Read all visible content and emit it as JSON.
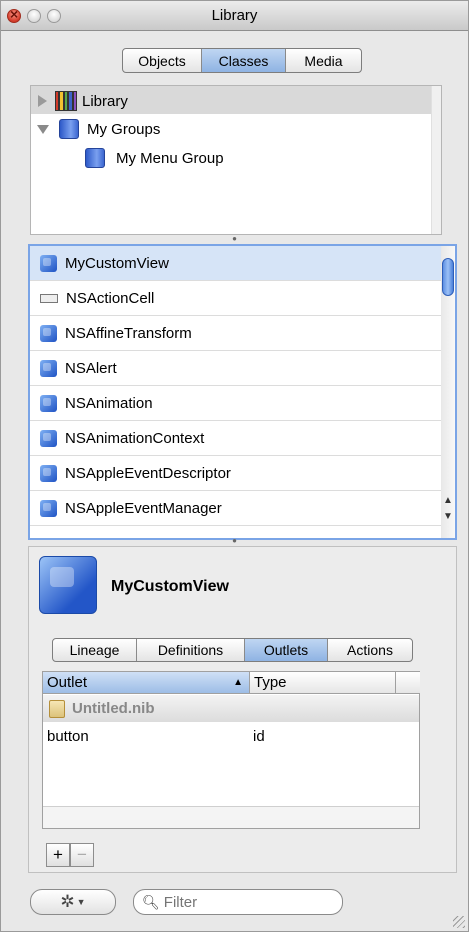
{
  "window": {
    "title": "Library"
  },
  "top_tabs": [
    "Objects",
    "Classes",
    "Media"
  ],
  "top_tabs_selected": "Classes",
  "tree": {
    "library": "Library",
    "my_groups": "My Groups",
    "my_menu_group": "My Menu Group"
  },
  "class_list": [
    {
      "label": "MyCustomView",
      "icon": "class-cube-icon"
    },
    {
      "label": "NSActionCell",
      "icon": "action-cell-icon"
    },
    {
      "label": "NSAffineTransform",
      "icon": "class-cube-icon"
    },
    {
      "label": "NSAlert",
      "icon": "class-cube-icon"
    },
    {
      "label": "NSAnimation",
      "icon": "class-cube-icon"
    },
    {
      "label": "NSAnimationContext",
      "icon": "class-cube-icon"
    },
    {
      "label": "NSAppleEventDescriptor",
      "icon": "class-cube-icon"
    },
    {
      "label": "NSAppleEventManager",
      "icon": "class-cube-icon"
    }
  ],
  "detail": {
    "class_name": "MyCustomView",
    "tabs": [
      "Lineage",
      "Definitions",
      "Outlets",
      "Actions"
    ],
    "selected_tab": "Outlets",
    "table": {
      "col_outlet": "Outlet",
      "col_type": "Type",
      "group": "Untitled.nib",
      "rows": [
        {
          "outlet": "button",
          "type": "id"
        }
      ]
    }
  },
  "bottom": {
    "add": "+",
    "remove": "−",
    "filter_placeholder": "Filter"
  },
  "colors": {
    "selection": "#d6e4f7",
    "accent": "#3b73d6"
  }
}
